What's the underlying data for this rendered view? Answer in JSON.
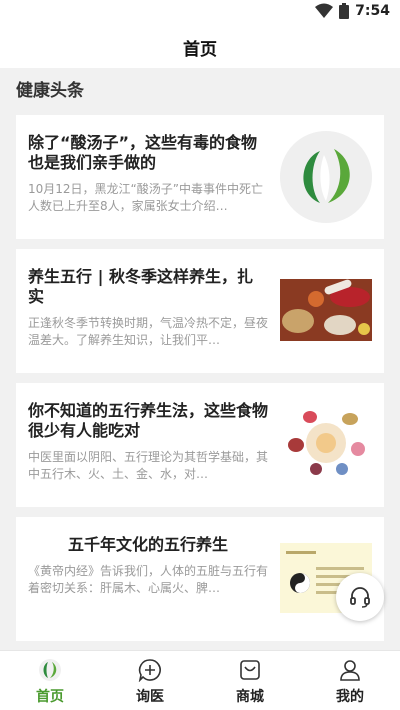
{
  "status_bar": {
    "time": "7:54"
  },
  "header": {
    "title": "首页"
  },
  "section": {
    "title": "健康头条"
  },
  "articles": [
    {
      "title": "除了“酸汤子”，这些有毒的食物也是我们亲手做的",
      "summary": "10月12日，黑龙江“酸汤子”中毒事件中死亡人数已上升至8人，家属张女士介绍…",
      "thumb": "leaf-logo"
    },
    {
      "title": "养生五行 | 秋冬季这样养生，扎实",
      "summary": "正逢秋冬季节转换时期，气温冷热不定，昼夜温差大。了解养生知识，让我们平…",
      "thumb": "herbs-photo"
    },
    {
      "title": "你不知道的五行养生法，这些食物很少有人能吃对",
      "summary": "中医里面以阴阳、五行理论为其哲学基础，其中五行木、火、土、金、水，对…",
      "thumb": "organs-diagram"
    },
    {
      "title": "五千年文化的五行养生",
      "summary": "《黄帝内经》告诉我们，人体的五脏与五行有着密切关系：肝属木、心属火、脾…",
      "thumb": "yin-yang-chart"
    }
  ],
  "tabbar": {
    "items": [
      {
        "label": "首页",
        "icon": "home-leaf-icon",
        "active": true
      },
      {
        "label": "询医",
        "icon": "consult-plus-icon",
        "active": false
      },
      {
        "label": "商城",
        "icon": "shop-bag-icon",
        "active": false
      },
      {
        "label": "我的",
        "icon": "profile-icon",
        "active": false
      }
    ]
  },
  "colors": {
    "accent": "#4a9a2e",
    "background": "#f1f1f1"
  }
}
